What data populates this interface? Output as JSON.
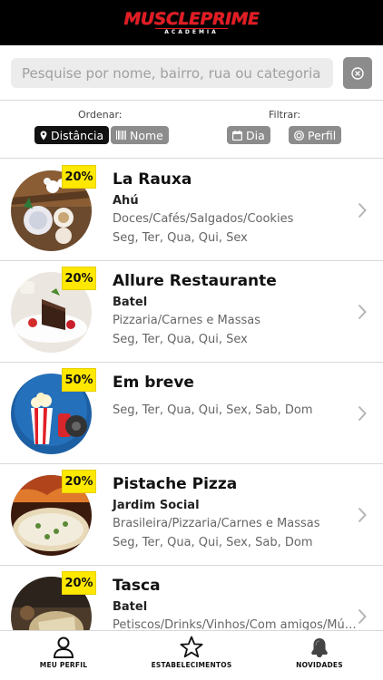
{
  "header": {
    "logo_main": "MusclePrime",
    "logo_sub": "ACADEMIA"
  },
  "search": {
    "placeholder": "Pesquise por nome, bairro, rua ou categoria..."
  },
  "sort": {
    "label": "Ordenar:",
    "options": [
      {
        "label": "Distância",
        "icon": "map-pin-icon",
        "active": true
      },
      {
        "label": "Nome",
        "icon": "barcode-icon",
        "active": false
      }
    ]
  },
  "filter": {
    "label": "Filtrar:",
    "options": [
      {
        "label": "Dia",
        "icon": "calendar-icon"
      },
      {
        "label": "Perfil",
        "icon": "target-icon"
      }
    ]
  },
  "establishments": [
    {
      "discount": "20%",
      "name": "La Rauxa",
      "neighborhood": "Ahú",
      "categories": "Doces/Cafés/Salgados/Cookies",
      "days": "Seg, Ter, Qua, Qui, Sex"
    },
    {
      "discount": "20%",
      "name": "Allure Restaurante",
      "neighborhood": "Batel",
      "categories": "Pizzaria/Carnes e Massas",
      "days": "Seg, Ter, Qua, Qui, Sex"
    },
    {
      "discount": "50%",
      "name": "Em breve",
      "neighborhood": "",
      "categories": "",
      "days": "Seg, Ter, Qua, Qui, Sex, Sab, Dom"
    },
    {
      "discount": "20%",
      "name": "Pistache Pizza",
      "neighborhood": "Jardim Social",
      "categories": "Brasileira/Pizzaria/Carnes e Massas",
      "days": "Seg, Ter, Qua, Qui, Sex, Sab, Dom"
    },
    {
      "discount": "20%",
      "name": "Tasca",
      "neighborhood": "Batel",
      "categories": "Petiscos/Drinks/Vinhos/Com amigos/Música",
      "days": ""
    }
  ],
  "tabs": [
    {
      "label": "MEU PERFIL",
      "icon": "user-icon"
    },
    {
      "label": "ESTABELECIMENTOS",
      "icon": "star-icon"
    },
    {
      "label": "NOVIDADES",
      "icon": "bell-icon"
    }
  ],
  "colors": {
    "brand_red": "#e31b23",
    "badge_yellow": "#ffe800",
    "chip_active": "#111111",
    "chip_inactive": "#8c8c8c"
  }
}
